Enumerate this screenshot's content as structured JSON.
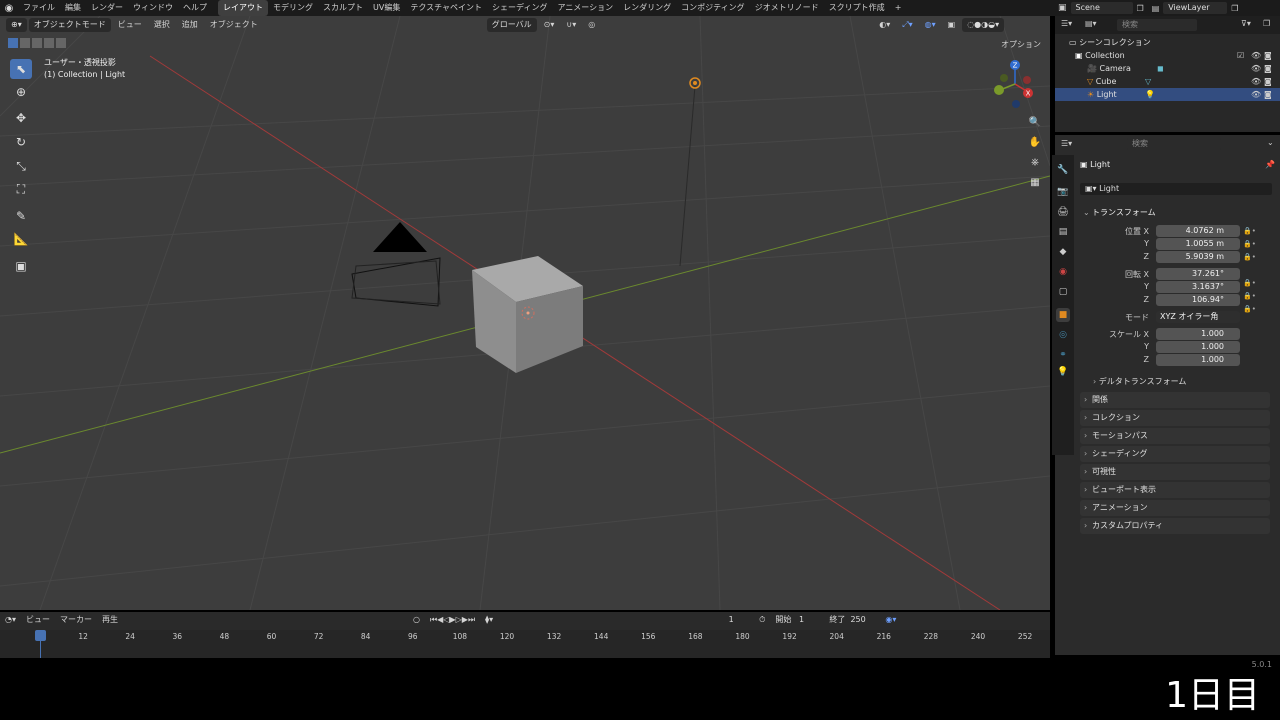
{
  "topbar": {
    "menus": [
      "ファイル",
      "編集",
      "レンダー",
      "ウィンドウ",
      "ヘルプ"
    ],
    "workspaces": [
      "レイアウト",
      "モデリング",
      "スカルプト",
      "UV編集",
      "テクスチャペイント",
      "シェーディング",
      "アニメーション",
      "レンダリング",
      "コンポジティング",
      "ジオメトリノード",
      "スクリプト作成"
    ],
    "active_workspace": "レイアウト",
    "scene": "Scene",
    "view_layer": "ViewLayer"
  },
  "viewport": {
    "mode": "オブジェクトモード",
    "menus": [
      "ビュー",
      "選択",
      "追加",
      "オブジェクト"
    ],
    "transform_orientation": "グローバル",
    "options_label": "オプション",
    "view_name": "ユーザー・透視投影",
    "context": "(1) Collection | Light",
    "axes": [
      "X",
      "Y",
      "Z"
    ]
  },
  "outliner": {
    "search_placeholder": "検索",
    "root": "シーンコレクション",
    "collection": "Collection",
    "items": [
      "Camera",
      "Cube",
      "Light"
    ],
    "selected": "Light"
  },
  "properties": {
    "search_placeholder": "検索",
    "object_name": "Light",
    "object_field": "Light",
    "transform_title": "トランスフォーム",
    "location_label": "位置 X",
    "location": [
      "4.0762 m",
      "1.0055 m",
      "5.9039 m"
    ],
    "rotation_label": "回転 X",
    "rotation": [
      "37.261°",
      "3.1637°",
      "106.94°"
    ],
    "mode_label": "モード",
    "mode_value": "XYZ オイラー角",
    "scale_label": "スケール X",
    "scale": [
      "1.000",
      "1.000",
      "1.000"
    ],
    "axis_y": "Y",
    "axis_z": "Z",
    "delta_transform": "デルタトランスフォーム",
    "panels": [
      "関係",
      "コレクション",
      "モーションパス",
      "シェーディング",
      "可視性",
      "ビューポート表示",
      "アニメーション",
      "カスタムプロパティ"
    ]
  },
  "timeline": {
    "menus": [
      "ビュー",
      "マーカー"
    ],
    "playback": "再生",
    "current_frame": "1",
    "start_label": "開始",
    "start": "1",
    "end_label": "終了",
    "end": "250",
    "ticks": [
      "1",
      "12",
      "24",
      "36",
      "48",
      "60",
      "72",
      "84",
      "96",
      "108",
      "120",
      "132",
      "144",
      "156",
      "168",
      "180",
      "192",
      "204",
      "216",
      "228",
      "240",
      "252"
    ]
  },
  "version": "5.0.1",
  "overlay_caption": "1日目"
}
